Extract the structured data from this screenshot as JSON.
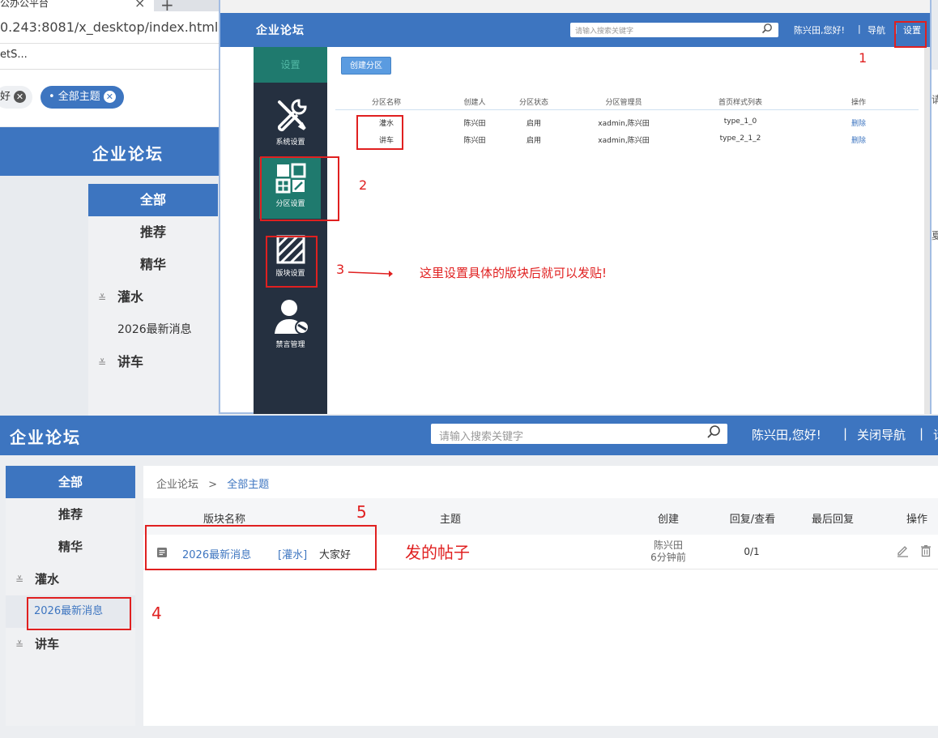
{
  "bg_browser": {
    "tab_title": "公办公平台",
    "url": "0.243:8081/x_desktop/index.html",
    "bookmark": "etS...",
    "chip1": "好",
    "chip2": "• 全部主题",
    "logo": "企业论坛",
    "nav": [
      "全部",
      "推荐",
      "精华",
      "灌水",
      "2026最新消息",
      "讲车"
    ],
    "right_glyphs": [
      "请",
      "夏"
    ]
  },
  "settings_window": {
    "logo": "企业论坛",
    "search_placeholder": "请输入搜索关键字",
    "greeting": "陈兴田,您好!",
    "separator": "|",
    "nav_link": "导航",
    "settings_link": "设置",
    "sidebar_head": "设置",
    "sidebar": {
      "system": "系统设置",
      "partition": "分区设置",
      "board": "版块设置",
      "mute": "禁言管理"
    },
    "create_button": "创建分区",
    "table": {
      "headers": [
        "分区名称",
        "创建人",
        "分区状态",
        "分区管理员",
        "首页样式列表",
        "操作"
      ],
      "rows": [
        [
          "灌水",
          "陈兴田",
          "启用",
          "xadmin,陈兴田",
          "type_1_0",
          "删除"
        ],
        [
          "讲车",
          "陈兴田",
          "启用",
          "xadmin,陈兴田",
          "type_2_1_2",
          "删除"
        ]
      ]
    }
  },
  "forum": {
    "logo": "企业论坛",
    "search_placeholder": "请输入搜索关键字",
    "greeting": "陈兴田,您好!",
    "separator": "|",
    "close_nav": "关闭导航",
    "extra": "请",
    "sidebar": [
      "全部",
      "推荐",
      "精华",
      "灌水",
      "2026最新消息",
      "讲车"
    ],
    "breadcrumb": {
      "root": "企业论坛",
      "sep": ">",
      "current": "全部主题"
    },
    "table_headers": [
      "版块名称",
      "主题",
      "创建",
      "回复/查看",
      "最后回复",
      "操作"
    ],
    "post": {
      "board": "2026最新消息",
      "tag": "[灌水]",
      "title": "大家好",
      "author": "陈兴田",
      "time": "6分钟前",
      "replies": "0/1"
    }
  },
  "annotations": {
    "n1": "1",
    "n2": "2",
    "n3": "3",
    "n4": "4",
    "n5": "5",
    "arrow_text": "这里设置具体的版块后就可以发贴!",
    "post_label": "发的帖子",
    "color": "#e02020"
  },
  "colors": {
    "brand_blue": "#3d75c0",
    "sidebar_dark": "#253040",
    "sidebar_teal": "#1f7a6e"
  }
}
